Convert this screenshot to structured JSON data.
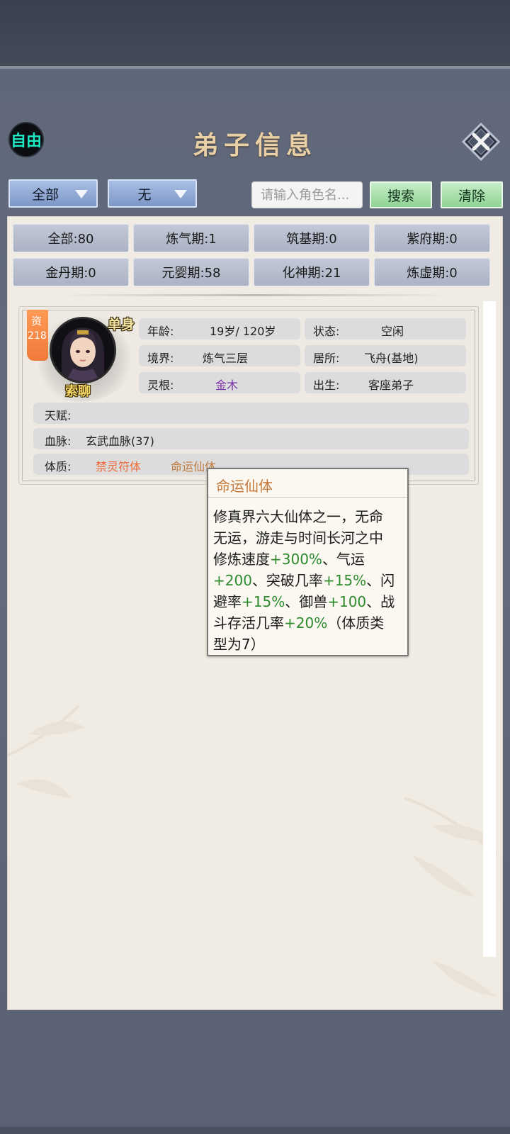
{
  "header": {
    "mode_badge": "自由",
    "title": "弟子信息",
    "close_icon": "close-x-icon"
  },
  "filters": {
    "dropdown1": "全部",
    "dropdown2": "无",
    "search_placeholder": "请输入角色名...",
    "search_value": "",
    "search_label": "搜索",
    "clear_label": "清除"
  },
  "stats": [
    "全部:80",
    "炼气期:1",
    "筑基期:0",
    "紫府期:0",
    "金丹期:0",
    "元婴期:58",
    "化神期:21",
    "炼虚期:0"
  ],
  "disciple": {
    "aptitude_label": "资",
    "aptitude_value": "218",
    "marital": "单身",
    "name": "索聊",
    "age_label": "年龄:",
    "age_value": "19岁/ 120岁",
    "state_label": "状态:",
    "state_value": "空闲",
    "realm_label": "境界:",
    "realm_value": "炼气三层",
    "residence_label": "居所:",
    "residence_value": "飞舟(基地)",
    "root_label": "灵根:",
    "root_value": "金木",
    "birth_label": "出生:",
    "birth_value": "客座弟子",
    "talent_label": "天赋:",
    "bloodline_label": "血脉:",
    "bloodline_value": "玄武血脉(37)",
    "physique_label": "体质:",
    "physique_1": "禁灵符体",
    "physique_2": "命运仙体"
  },
  "tooltip": {
    "title": "命运仙体",
    "line1": "修真界六大仙体之一，无命",
    "line2": "无运，游走与时间长河之中",
    "line3a": "修炼速度",
    "line3b": "+300%",
    "line3c": "、气运",
    "line4a": "+200",
    "line4b": "、突破几率",
    "line4c": "+15%",
    "line4d": "、闪",
    "line5a": "避率",
    "line5b": "+15%",
    "line5c": "、御兽",
    "line5d": "+100",
    "line5e": "、战",
    "line6a": "斗存活几率",
    "line6b": "+20%",
    "line6c": "（体质类",
    "line7": "型为7）"
  },
  "colors": {
    "physique_1": "#ee6a3a",
    "physique_2": "#c07a3c",
    "root_value": "#7a2ea8",
    "bonus_green": "#2d8a2d"
  }
}
